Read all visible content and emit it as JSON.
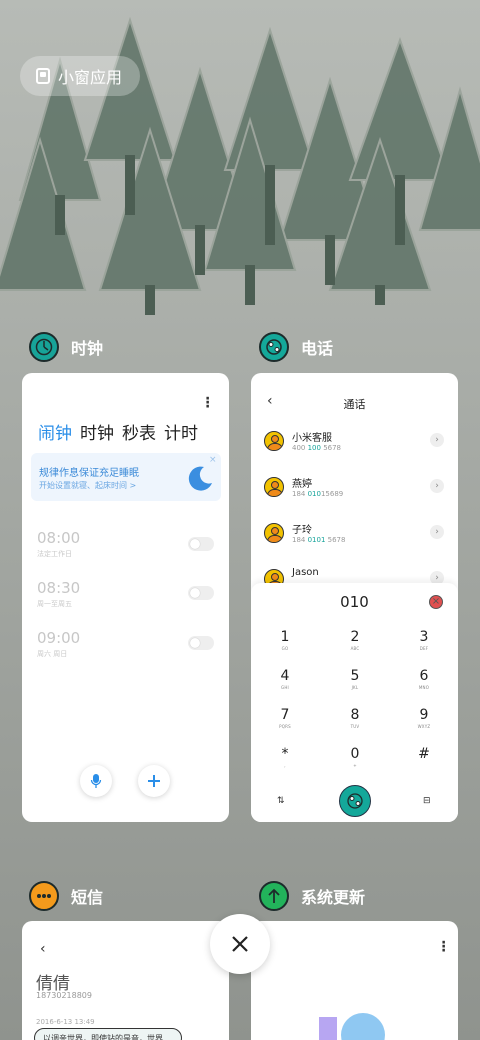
{
  "floating_window": {
    "label": "小窗应用",
    "icon": "floating-window-icon"
  },
  "apps": {
    "clock": {
      "name": "时钟",
      "icon": "clock-icon",
      "accent": "#17a398",
      "tabs": [
        "闹钟",
        "时钟",
        "秒表",
        "计时"
      ],
      "banner": {
        "title": "规律作息保证充足睡眠",
        "subtitle": "开始设置就寝、起床时间 >"
      },
      "alarms": [
        {
          "time": "08:00",
          "repeat": "法定工作日"
        },
        {
          "time": "08:30",
          "repeat": "周一至周五"
        },
        {
          "time": "09:00",
          "repeat": "周六 周日"
        }
      ]
    },
    "phone": {
      "name": "电话",
      "icon": "phone-icon",
      "accent": "#14a89a",
      "title": "通话",
      "contacts": [
        {
          "name": "小米客服",
          "num_prefix": "400 ",
          "num_hl": "100",
          "num_suffix": " 5678"
        },
        {
          "name": "燕婷",
          "num_prefix": "184 ",
          "num_hl": "010",
          "num_suffix": "15689"
        },
        {
          "name": "子玲",
          "num_prefix": "184 ",
          "num_hl": "0101",
          "num_suffix": " 5678"
        },
        {
          "name": "Jason",
          "num_prefix": "",
          "num_hl": "",
          "num_suffix": ""
        }
      ],
      "dial_input": "010",
      "keys": [
        {
          "d": "1",
          "l": "GO"
        },
        {
          "d": "2",
          "l": "ABC"
        },
        {
          "d": "3",
          "l": "DEF"
        },
        {
          "d": "4",
          "l": "GHI"
        },
        {
          "d": "5",
          "l": "JKL"
        },
        {
          "d": "6",
          "l": "MNO"
        },
        {
          "d": "7",
          "l": "PQRS"
        },
        {
          "d": "8",
          "l": "TUV"
        },
        {
          "d": "9",
          "l": "WXYZ"
        },
        {
          "d": "*",
          "l": ","
        },
        {
          "d": "0",
          "l": "+"
        },
        {
          "d": "#",
          "l": ""
        }
      ]
    },
    "sms": {
      "name": "短信",
      "icon": "message-icon",
      "accent": "#f39a1c",
      "contact": "倩倩",
      "number": "18730218809",
      "date": "2016-6-13 13:49",
      "preview": "以调亲世界，即使站的是音，世界"
    },
    "update": {
      "name": "系统更新",
      "icon": "update-arrow-icon",
      "accent": "#22b35b"
    }
  },
  "close_button": {
    "icon": "close-icon"
  }
}
